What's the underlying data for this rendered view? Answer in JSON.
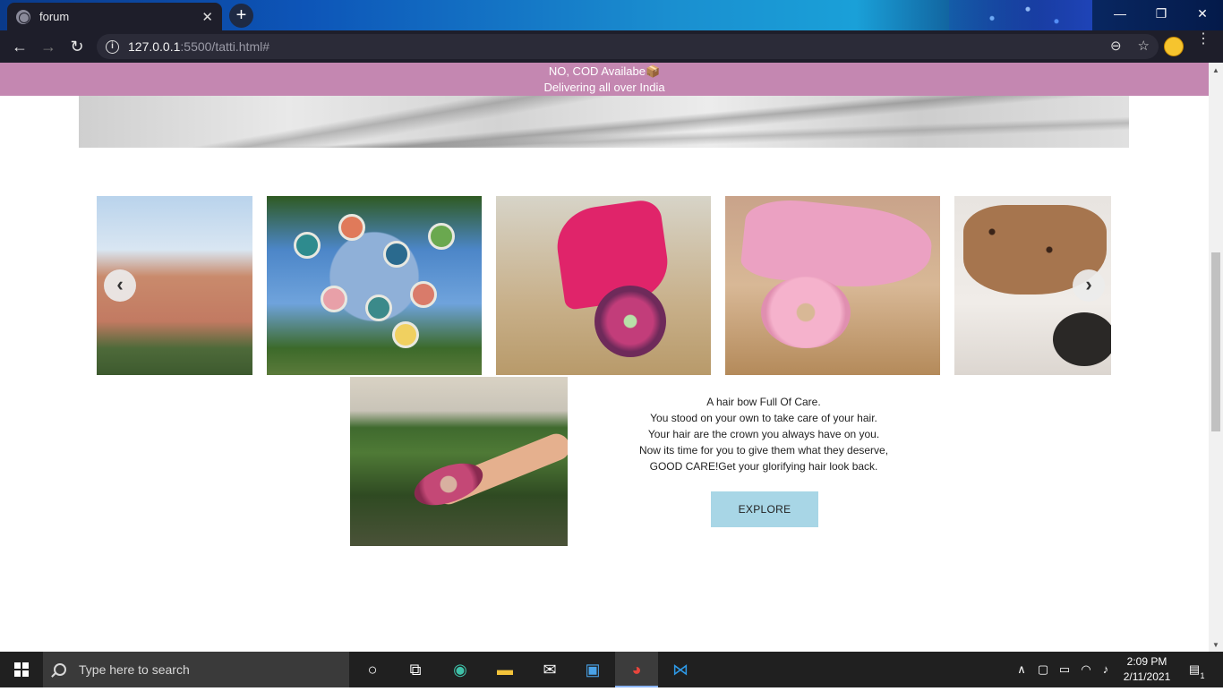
{
  "browser": {
    "tab_title": "forum",
    "tab_close": "✕",
    "new_tab": "+",
    "url_host": "127.0.0.1",
    "url_rest": ":5500/tatti.html#",
    "info_glyph": "i",
    "back": "←",
    "forward": "→",
    "reload": "↻",
    "zoom_icon": "⊖",
    "star_icon": "☆",
    "menu_icon": "⋮",
    "window_minimize": "—",
    "window_restore": "❐",
    "window_close": "✕"
  },
  "announcement": {
    "line1": "NO, COD Availabe",
    "line1_suffix": "📦",
    "line2": "Delivering all over India"
  },
  "carousel": {
    "prev_glyph": "‹",
    "next_glyph": "›",
    "images": [
      "scrunchie-on-wrist-sky",
      "hair-care-tins",
      "pink-mask-and-floral-scrunchie",
      "pink-mask-and-pink-scrunchie",
      "leopard-mask"
    ]
  },
  "feature": {
    "lines": [
      "A hair bow Full Of Care.",
      "You stood on your own to take care of your hair.",
      "Your hair are the crown you always have on you.",
      "Now its time for you to give them what they deserve,",
      "GOOD CARE!Get your glorifying hair look back."
    ],
    "button": "EXPLORE"
  },
  "taskbar": {
    "search_placeholder": "Type here to search",
    "time": "2:09 PM",
    "date": "2/11/2021",
    "notification_count": "1"
  },
  "colors": {
    "announcement_bg": "#c487b1",
    "explore_bg": "#a8d6e6",
    "chrome_dark": "#1e1e2a"
  }
}
